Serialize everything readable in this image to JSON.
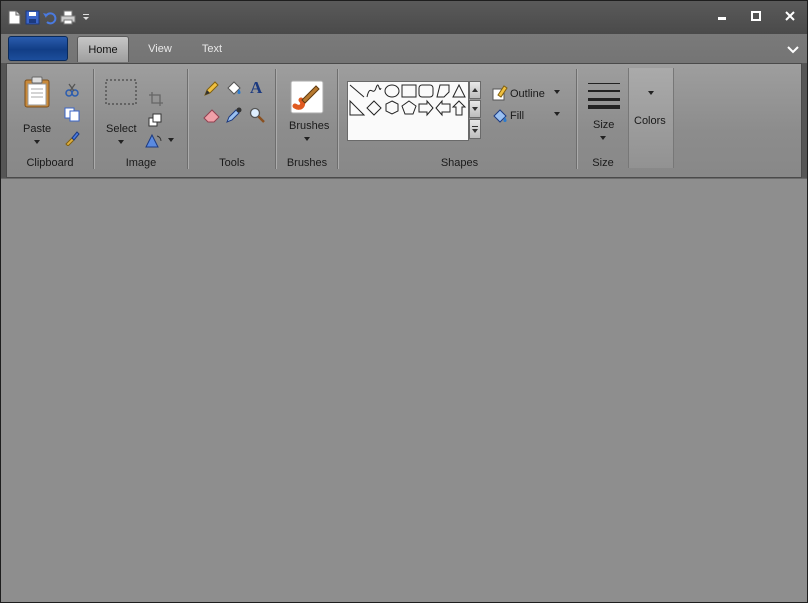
{
  "tabs": [
    {
      "label": "Home"
    },
    {
      "label": "View"
    },
    {
      "label": "Text"
    }
  ],
  "groups": {
    "clipboard": {
      "label": "Clipboard",
      "paste": "Paste"
    },
    "image": {
      "label": "Image",
      "select": "Select"
    },
    "tools": {
      "label": "Tools"
    },
    "brushes": {
      "label": "Brushes",
      "button": "Brushes"
    },
    "shapes": {
      "label": "Shapes",
      "outline": "Outline",
      "fill": "Fill"
    },
    "size": {
      "label": "Size",
      "button": "Size"
    },
    "colors": {
      "button": "Colors"
    }
  },
  "icons": {
    "qat": [
      "new-icon",
      "save-icon",
      "undo-icon",
      "print-icon",
      "customize-arrow-icon"
    ],
    "window": [
      "minimize-icon",
      "maximize-icon",
      "close-icon"
    ]
  },
  "colors": {
    "app_button": "#1c4e9c",
    "workspace": "#8e8e8e",
    "ribbon": "#999999",
    "titlebar": "#505050"
  }
}
